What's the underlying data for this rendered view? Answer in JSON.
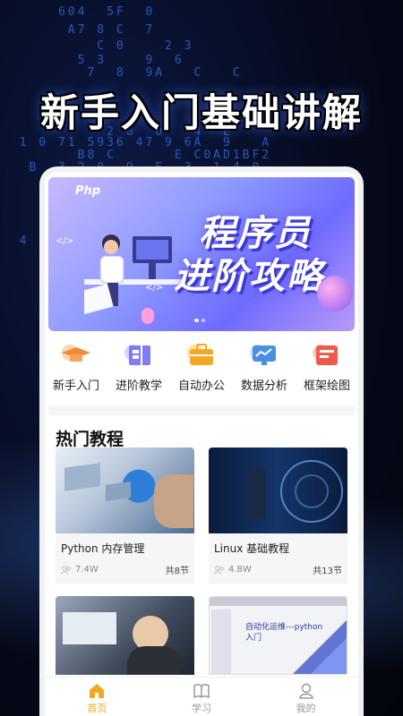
{
  "promo": {
    "headline": "新手入门基础讲解",
    "hex_rows": [
      "      604  5F  0",
      "       A7 8 C  7",
      "          C 0    2 3",
      "        5 3    9  6",
      "         7  8  9A   C   C",
      "           2 6  0   4  E",
      "  1 0 71 5936 47 9 6A  9   A",
      "        B8 C      E C0AD1BF2",
      "   B  3 2 0  9  F  3  1 4 0",
      "  4"
    ]
  },
  "banner": {
    "badge": "Php",
    "title_line1": "程序员",
    "title_line2": "进阶攻略",
    "code_tag1": "</>",
    "code_tag2": "</>",
    "active_dot": 0
  },
  "categories": [
    {
      "label": "新手入门",
      "icon": "graduation-cap-icon",
      "color": "#f28a3a"
    },
    {
      "label": "进阶教学",
      "icon": "book-icon",
      "color": "#7f7cf5"
    },
    {
      "label": "自动办公",
      "icon": "briefcase-icon",
      "color": "#f5a623"
    },
    {
      "label": "数据分析",
      "icon": "chart-screen-icon",
      "color": "#4a90e2"
    },
    {
      "label": "框架绘图",
      "icon": "frame-drawing-icon",
      "color": "#ee5a4c"
    }
  ],
  "section": {
    "title": "热门教程"
  },
  "courses": [
    {
      "title": "Python 内存管理",
      "views": "7.4W",
      "lessons": "共8节"
    },
    {
      "title": "Linux 基础教程",
      "views": "4.8W",
      "lessons": "共13节"
    },
    {
      "title": "",
      "views": "",
      "lessons": ""
    },
    {
      "title": "",
      "views": "",
      "lessons": "",
      "thumb_caption_1": "自动化运维---python",
      "thumb_caption_2": "入门"
    }
  ],
  "tabbar": [
    {
      "label": "首页",
      "icon": "home-icon",
      "active": true
    },
    {
      "label": "学习",
      "icon": "book-open-icon",
      "active": false
    },
    {
      "label": "我的",
      "icon": "user-icon",
      "active": false
    }
  ],
  "colors": {
    "accent": "#f5a623",
    "banner_blue": "#3b3bd0"
  }
}
